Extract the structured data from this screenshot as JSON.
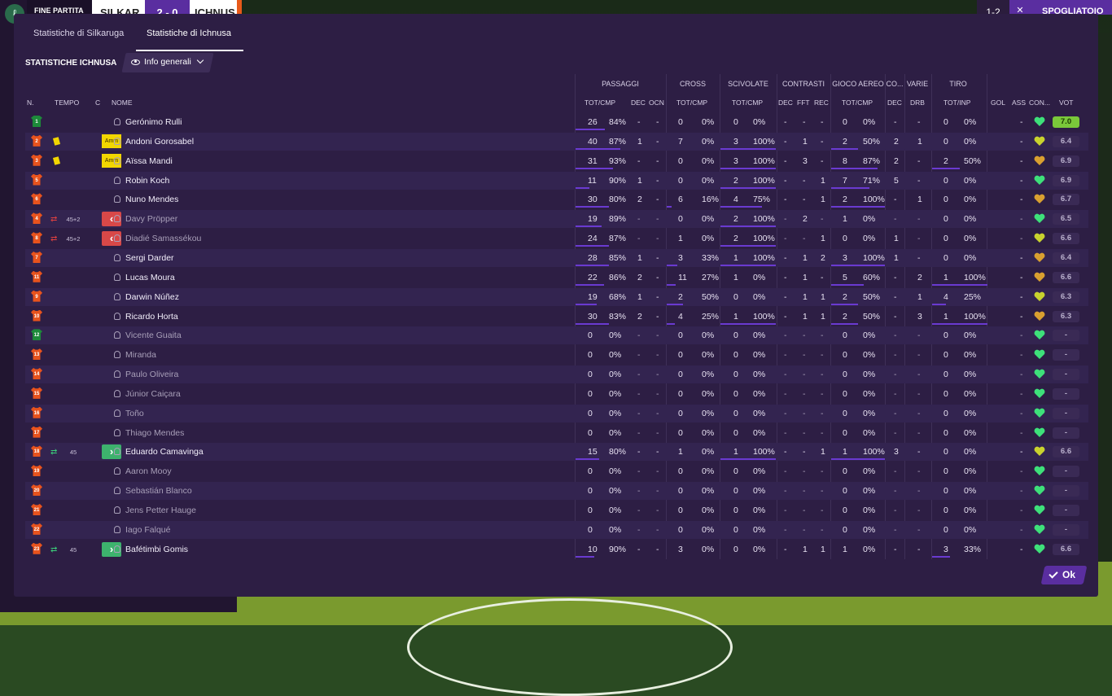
{
  "topbar": {
    "logo_glyph": "ℓ",
    "status": "FINE PARTITA",
    "home_team": "SILKAR",
    "score": "2 - 0",
    "away_team": "ICHNUS",
    "right_a": "1-2",
    "right_b": "✕",
    "right_c": "SPOGLIATOIO"
  },
  "tabs": [
    {
      "label": "Statistiche di Silkaruga",
      "active": false
    },
    {
      "label": "Statistiche di Ichnusa",
      "active": true
    }
  ],
  "section": {
    "title": "STATISTICHE ICHNUSA",
    "dropdown_label": "Info generali",
    "dropdown_icon": "eye-icon"
  },
  "columns": {
    "num": "N.",
    "time": "TEMPO",
    "c": "C",
    "name": "NOME",
    "groups": {
      "passaggi": "PASSAGGI",
      "cross": "CROSS",
      "scivolate": "SCIVOLATE",
      "contrasti": "CONTRASTI",
      "gioco_aereo": "GIOCO AEREO",
      "co": "CO...",
      "varie": "VARIE",
      "tiro": "TIRO"
    },
    "sub": {
      "pass_tot": "TOT/CMP",
      "pass_dec": "DEC",
      "pass_ocn": "OCN",
      "cross_tot": "TOT/CMP",
      "sciv_tot": "TOT/CMP",
      "contr_dec": "DEC",
      "contr_fft": "FFT",
      "contr_rec": "REC",
      "aereo_tot": "TOT/CMP",
      "co_dec": "DEC",
      "varie_drb": "DRB",
      "tiro_tot": "TOT/INP",
      "gol": "GOL",
      "ass": "ASS",
      "con": "CON...",
      "vot": "VOT"
    }
  },
  "colors": {
    "dialog_bg": "#2d1e44",
    "accent": "#5a2ea0",
    "bar": "#6a3ad0",
    "shirt": "#e8531d",
    "gk_shirt": "#1d8a3a",
    "best_rating": "#7ac83a"
  },
  "players": [
    {
      "num": "1",
      "gk": true,
      "name": "Gerónimo Rulli",
      "sub": false,
      "card": "",
      "subdir": "",
      "subtime": "",
      "pass": "26",
      "passpct": "84%",
      "pass_frac": 0.62,
      "pdec": "-",
      "pocn": "-",
      "cross": "0",
      "crosspct": "0%",
      "cross_frac": 0,
      "sciv": "0",
      "scivpct": "0%",
      "sciv_frac": 0,
      "cdec": "-",
      "cfft": "-",
      "crec": "-",
      "aer": "0",
      "aerpct": "0%",
      "aer_frac": 0,
      "codec": "-",
      "drb": "-",
      "tiro": "0",
      "tiropct": "0%",
      "tiro_frac": 0,
      "gol": "",
      "ass": "-",
      "heart": "green",
      "vot": "7.0",
      "best": true
    },
    {
      "num": "2",
      "gk": false,
      "name": "Andoni Gorosabel",
      "sub": false,
      "card": "yellow",
      "amm": "Amm",
      "subdir": "",
      "subtime": "",
      "pass": "40",
      "passpct": "87%",
      "pass_frac": 0.95,
      "pdec": "1",
      "pocn": "-",
      "cross": "7",
      "crosspct": "0%",
      "cross_frac": 0,
      "sciv": "3",
      "scivpct": "100%",
      "sciv_frac": 1,
      "cdec": "-",
      "cfft": "1",
      "crec": "-",
      "aer": "2",
      "aerpct": "50%",
      "aer_frac": 0.5,
      "codec": "2",
      "drb": "1",
      "tiro": "0",
      "tiropct": "0%",
      "tiro_frac": 0,
      "gol": "",
      "ass": "-",
      "heart": "yellow",
      "vot": "6.4",
      "best": false
    },
    {
      "num": "3",
      "gk": false,
      "name": "Aïssa Mandi",
      "sub": false,
      "card": "yellow",
      "amm": "Amm",
      "subdir": "",
      "subtime": "",
      "pass": "31",
      "passpct": "93%",
      "pass_frac": 0.8,
      "pdec": "-",
      "pocn": "-",
      "cross": "0",
      "crosspct": "0%",
      "cross_frac": 0,
      "sciv": "3",
      "scivpct": "100%",
      "sciv_frac": 1,
      "cdec": "-",
      "cfft": "3",
      "crec": "-",
      "aer": "8",
      "aerpct": "87%",
      "aer_frac": 0.87,
      "codec": "2",
      "drb": "-",
      "tiro": "2",
      "tiropct": "50%",
      "tiro_frac": 0.5,
      "gol": "",
      "ass": "-",
      "heart": "orange",
      "vot": "6.9",
      "best": false
    },
    {
      "num": "5",
      "gk": false,
      "name": "Robin Koch",
      "sub": false,
      "card": "",
      "subdir": "",
      "subtime": "",
      "pass": "11",
      "passpct": "90%",
      "pass_frac": 0.3,
      "pdec": "1",
      "pocn": "-",
      "cross": "0",
      "crosspct": "0%",
      "cross_frac": 0,
      "sciv": "2",
      "scivpct": "100%",
      "sciv_frac": 1,
      "cdec": "-",
      "cfft": "-",
      "crec": "1",
      "aer": "7",
      "aerpct": "71%",
      "aer_frac": 0.71,
      "codec": "5",
      "drb": "-",
      "tiro": "0",
      "tiropct": "0%",
      "tiro_frac": 0,
      "gol": "",
      "ass": "-",
      "heart": "green",
      "vot": "6.9",
      "best": false
    },
    {
      "num": "6",
      "gk": false,
      "name": "Nuno Mendes",
      "sub": false,
      "card": "",
      "subdir": "",
      "subtime": "",
      "pass": "30",
      "passpct": "80%",
      "pass_frac": 0.7,
      "pdec": "2",
      "pocn": "-",
      "cross": "6",
      "crosspct": "16%",
      "cross_frac": 0.16,
      "sciv": "4",
      "scivpct": "75%",
      "sciv_frac": 0.75,
      "cdec": "-",
      "cfft": "-",
      "crec": "1",
      "aer": "2",
      "aerpct": "100%",
      "aer_frac": 1,
      "codec": "-",
      "drb": "1",
      "tiro": "0",
      "tiropct": "0%",
      "tiro_frac": 0,
      "gol": "",
      "ass": "-",
      "heart": "orange",
      "vot": "6.7",
      "best": false
    },
    {
      "num": "4",
      "gk": false,
      "name": "Davy Pröpper",
      "sub": true,
      "card": "",
      "subdir": "out",
      "subtime": "45+2",
      "pass": "19",
      "passpct": "89%",
      "pass_frac": 0.55,
      "pdec": "-",
      "pocn": "-",
      "cross": "0",
      "crosspct": "0%",
      "cross_frac": 0,
      "sciv": "2",
      "scivpct": "100%",
      "sciv_frac": 1,
      "cdec": "-",
      "cfft": "2",
      "crec": "-",
      "aer": "1",
      "aerpct": "0%",
      "aer_frac": 0,
      "codec": "-",
      "drb": "-",
      "tiro": "0",
      "tiropct": "0%",
      "tiro_frac": 0,
      "gol": "",
      "ass": "-",
      "heart": "green",
      "vot": "6.5",
      "best": false
    },
    {
      "num": "8",
      "gk": false,
      "name": "Diadié Samassékou",
      "sub": true,
      "card": "",
      "subdir": "out",
      "subtime": "45+2",
      "pass": "24",
      "passpct": "87%",
      "pass_frac": 0.7,
      "pdec": "-",
      "pocn": "-",
      "cross": "1",
      "crosspct": "0%",
      "cross_frac": 0,
      "sciv": "2",
      "scivpct": "100%",
      "sciv_frac": 1,
      "cdec": "-",
      "cfft": "-",
      "crec": "1",
      "aer": "0",
      "aerpct": "0%",
      "aer_frac": 0,
      "codec": "1",
      "drb": "-",
      "tiro": "0",
      "tiropct": "0%",
      "tiro_frac": 0,
      "gol": "",
      "ass": "-",
      "heart": "yellow",
      "vot": "6.6",
      "best": false
    },
    {
      "num": "7",
      "gk": false,
      "name": "Sergi Darder",
      "sub": false,
      "card": "",
      "subdir": "",
      "subtime": "",
      "pass": "28",
      "passpct": "85%",
      "pass_frac": 0.7,
      "pdec": "1",
      "pocn": "-",
      "cross": "3",
      "crosspct": "33%",
      "cross_frac": 0.33,
      "sciv": "1",
      "scivpct": "100%",
      "sciv_frac": 1,
      "cdec": "-",
      "cfft": "1",
      "crec": "2",
      "aer": "3",
      "aerpct": "100%",
      "aer_frac": 1,
      "codec": "1",
      "drb": "-",
      "tiro": "0",
      "tiropct": "0%",
      "tiro_frac": 0,
      "gol": "",
      "ass": "-",
      "heart": "orange",
      "vot": "6.4",
      "best": false
    },
    {
      "num": "11",
      "gk": false,
      "name": "Lucas Moura",
      "sub": false,
      "card": "",
      "subdir": "",
      "subtime": "",
      "pass": "22",
      "passpct": "86%",
      "pass_frac": 0.6,
      "pdec": "2",
      "pocn": "-",
      "cross": "11",
      "crosspct": "27%",
      "cross_frac": 0.27,
      "sciv": "1",
      "scivpct": "0%",
      "sciv_frac": 0,
      "cdec": "-",
      "cfft": "1",
      "crec": "-",
      "aer": "5",
      "aerpct": "60%",
      "aer_frac": 0.6,
      "codec": "-",
      "drb": "2",
      "tiro": "1",
      "tiropct": "100%",
      "tiro_frac": 1,
      "gol": "",
      "ass": "-",
      "heart": "orange",
      "vot": "6.6",
      "best": false
    },
    {
      "num": "9",
      "gk": false,
      "name": "Darwin Núñez",
      "sub": false,
      "card": "",
      "subdir": "",
      "subtime": "",
      "pass": "19",
      "passpct": "68%",
      "pass_frac": 0.45,
      "pdec": "1",
      "pocn": "-",
      "cross": "2",
      "crosspct": "50%",
      "cross_frac": 0.5,
      "sciv": "0",
      "scivpct": "0%",
      "sciv_frac": 0,
      "cdec": "-",
      "cfft": "1",
      "crec": "1",
      "aer": "2",
      "aerpct": "50%",
      "aer_frac": 0.5,
      "codec": "-",
      "drb": "1",
      "tiro": "4",
      "tiropct": "25%",
      "tiro_frac": 0.25,
      "gol": "",
      "ass": "-",
      "heart": "yellow",
      "vot": "6.3",
      "best": false
    },
    {
      "num": "10",
      "gk": false,
      "name": "Ricardo Horta",
      "sub": false,
      "card": "",
      "subdir": "",
      "subtime": "",
      "pass": "30",
      "passpct": "83%",
      "pass_frac": 0.7,
      "pdec": "2",
      "pocn": "-",
      "cross": "4",
      "crosspct": "25%",
      "cross_frac": 0.25,
      "sciv": "1",
      "scivpct": "100%",
      "sciv_frac": 1,
      "cdec": "-",
      "cfft": "1",
      "crec": "1",
      "aer": "2",
      "aerpct": "50%",
      "aer_frac": 0.5,
      "codec": "-",
      "drb": "3",
      "tiro": "1",
      "tiropct": "100%",
      "tiro_frac": 1,
      "gol": "",
      "ass": "-",
      "heart": "orange",
      "vot": "6.3",
      "best": false
    },
    {
      "num": "12",
      "gk": true,
      "name": "Vicente Guaita",
      "sub": true,
      "card": "",
      "subdir": "",
      "subtime": "",
      "pass": "0",
      "passpct": "0%",
      "pass_frac": 0,
      "pdec": "-",
      "pocn": "-",
      "cross": "0",
      "crosspct": "0%",
      "cross_frac": 0,
      "sciv": "0",
      "scivpct": "0%",
      "sciv_frac": 0,
      "cdec": "-",
      "cfft": "-",
      "crec": "-",
      "aer": "0",
      "aerpct": "0%",
      "aer_frac": 0,
      "codec": "-",
      "drb": "-",
      "tiro": "0",
      "tiropct": "0%",
      "tiro_frac": 0,
      "gol": "",
      "ass": "-",
      "heart": "green",
      "vot": "-",
      "best": false
    },
    {
      "num": "13",
      "gk": false,
      "name": "Miranda",
      "sub": true,
      "card": "",
      "subdir": "",
      "subtime": "",
      "pass": "0",
      "passpct": "0%",
      "pass_frac": 0,
      "pdec": "-",
      "pocn": "-",
      "cross": "0",
      "crosspct": "0%",
      "cross_frac": 0,
      "sciv": "0",
      "scivpct": "0%",
      "sciv_frac": 0,
      "cdec": "-",
      "cfft": "-",
      "crec": "-",
      "aer": "0",
      "aerpct": "0%",
      "aer_frac": 0,
      "codec": "-",
      "drb": "-",
      "tiro": "0",
      "tiropct": "0%",
      "tiro_frac": 0,
      "gol": "",
      "ass": "-",
      "heart": "green",
      "vot": "-",
      "best": false
    },
    {
      "num": "14",
      "gk": false,
      "name": "Paulo Oliveira",
      "sub": true,
      "card": "",
      "subdir": "",
      "subtime": "",
      "pass": "0",
      "passpct": "0%",
      "pass_frac": 0,
      "pdec": "-",
      "pocn": "-",
      "cross": "0",
      "crosspct": "0%",
      "cross_frac": 0,
      "sciv": "0",
      "scivpct": "0%",
      "sciv_frac": 0,
      "cdec": "-",
      "cfft": "-",
      "crec": "-",
      "aer": "0",
      "aerpct": "0%",
      "aer_frac": 0,
      "codec": "-",
      "drb": "-",
      "tiro": "0",
      "tiropct": "0%",
      "tiro_frac": 0,
      "gol": "",
      "ass": "-",
      "heart": "green",
      "vot": "-",
      "best": false
    },
    {
      "num": "15",
      "gk": false,
      "name": "Júnior Caiçara",
      "sub": true,
      "card": "",
      "subdir": "",
      "subtime": "",
      "pass": "0",
      "passpct": "0%",
      "pass_frac": 0,
      "pdec": "-",
      "pocn": "-",
      "cross": "0",
      "crosspct": "0%",
      "cross_frac": 0,
      "sciv": "0",
      "scivpct": "0%",
      "sciv_frac": 0,
      "cdec": "-",
      "cfft": "-",
      "crec": "-",
      "aer": "0",
      "aerpct": "0%",
      "aer_frac": 0,
      "codec": "-",
      "drb": "-",
      "tiro": "0",
      "tiropct": "0%",
      "tiro_frac": 0,
      "gol": "",
      "ass": "-",
      "heart": "green",
      "vot": "-",
      "best": false
    },
    {
      "num": "16",
      "gk": false,
      "name": "Toño",
      "sub": true,
      "card": "",
      "subdir": "",
      "subtime": "",
      "pass": "0",
      "passpct": "0%",
      "pass_frac": 0,
      "pdec": "-",
      "pocn": "-",
      "cross": "0",
      "crosspct": "0%",
      "cross_frac": 0,
      "sciv": "0",
      "scivpct": "0%",
      "sciv_frac": 0,
      "cdec": "-",
      "cfft": "-",
      "crec": "-",
      "aer": "0",
      "aerpct": "0%",
      "aer_frac": 0,
      "codec": "-",
      "drb": "-",
      "tiro": "0",
      "tiropct": "0%",
      "tiro_frac": 0,
      "gol": "",
      "ass": "-",
      "heart": "green",
      "vot": "-",
      "best": false
    },
    {
      "num": "17",
      "gk": false,
      "name": "Thiago Mendes",
      "sub": true,
      "card": "",
      "subdir": "",
      "subtime": "",
      "pass": "0",
      "passpct": "0%",
      "pass_frac": 0,
      "pdec": "-",
      "pocn": "-",
      "cross": "0",
      "crosspct": "0%",
      "cross_frac": 0,
      "sciv": "0",
      "scivpct": "0%",
      "sciv_frac": 0,
      "cdec": "-",
      "cfft": "-",
      "crec": "-",
      "aer": "0",
      "aerpct": "0%",
      "aer_frac": 0,
      "codec": "-",
      "drb": "-",
      "tiro": "0",
      "tiropct": "0%",
      "tiro_frac": 0,
      "gol": "",
      "ass": "-",
      "heart": "green",
      "vot": "-",
      "best": false
    },
    {
      "num": "18",
      "gk": false,
      "name": "Eduardo Camavinga",
      "sub": false,
      "card": "",
      "subdir": "in",
      "subtime": "45",
      "pass": "15",
      "passpct": "80%",
      "pass_frac": 0.5,
      "pdec": "-",
      "pocn": "-",
      "cross": "1",
      "crosspct": "0%",
      "cross_frac": 0,
      "sciv": "1",
      "scivpct": "100%",
      "sciv_frac": 1,
      "cdec": "-",
      "cfft": "-",
      "crec": "1",
      "aer": "1",
      "aerpct": "100%",
      "aer_frac": 1,
      "codec": "3",
      "drb": "-",
      "tiro": "0",
      "tiropct": "0%",
      "tiro_frac": 0,
      "gol": "",
      "ass": "-",
      "heart": "yellow",
      "vot": "6.6",
      "best": false
    },
    {
      "num": "19",
      "gk": false,
      "name": "Aaron Mooy",
      "sub": true,
      "card": "",
      "subdir": "",
      "subtime": "",
      "pass": "0",
      "passpct": "0%",
      "pass_frac": 0,
      "pdec": "-",
      "pocn": "-",
      "cross": "0",
      "crosspct": "0%",
      "cross_frac": 0,
      "sciv": "0",
      "scivpct": "0%",
      "sciv_frac": 0,
      "cdec": "-",
      "cfft": "-",
      "crec": "-",
      "aer": "0",
      "aerpct": "0%",
      "aer_frac": 0,
      "codec": "-",
      "drb": "-",
      "tiro": "0",
      "tiropct": "0%",
      "tiro_frac": 0,
      "gol": "",
      "ass": "-",
      "heart": "green",
      "vot": "-",
      "best": false
    },
    {
      "num": "20",
      "gk": false,
      "name": "Sebastián Blanco",
      "sub": true,
      "card": "",
      "subdir": "",
      "subtime": "",
      "pass": "0",
      "passpct": "0%",
      "pass_frac": 0,
      "pdec": "-",
      "pocn": "-",
      "cross": "0",
      "crosspct": "0%",
      "cross_frac": 0,
      "sciv": "0",
      "scivpct": "0%",
      "sciv_frac": 0,
      "cdec": "-",
      "cfft": "-",
      "crec": "-",
      "aer": "0",
      "aerpct": "0%",
      "aer_frac": 0,
      "codec": "-",
      "drb": "-",
      "tiro": "0",
      "tiropct": "0%",
      "tiro_frac": 0,
      "gol": "",
      "ass": "-",
      "heart": "green",
      "vot": "-",
      "best": false
    },
    {
      "num": "21",
      "gk": false,
      "name": "Jens Petter Hauge",
      "sub": true,
      "card": "",
      "subdir": "",
      "subtime": "",
      "pass": "0",
      "passpct": "0%",
      "pass_frac": 0,
      "pdec": "-",
      "pocn": "-",
      "cross": "0",
      "crosspct": "0%",
      "cross_frac": 0,
      "sciv": "0",
      "scivpct": "0%",
      "sciv_frac": 0,
      "cdec": "-",
      "cfft": "-",
      "crec": "-",
      "aer": "0",
      "aerpct": "0%",
      "aer_frac": 0,
      "codec": "-",
      "drb": "-",
      "tiro": "0",
      "tiropct": "0%",
      "tiro_frac": 0,
      "gol": "",
      "ass": "-",
      "heart": "green",
      "vot": "-",
      "best": false
    },
    {
      "num": "22",
      "gk": false,
      "name": "Iago Falqué",
      "sub": true,
      "card": "",
      "subdir": "",
      "subtime": "",
      "pass": "0",
      "passpct": "0%",
      "pass_frac": 0,
      "pdec": "-",
      "pocn": "-",
      "cross": "0",
      "crosspct": "0%",
      "cross_frac": 0,
      "sciv": "0",
      "scivpct": "0%",
      "sciv_frac": 0,
      "cdec": "-",
      "cfft": "-",
      "crec": "-",
      "aer": "0",
      "aerpct": "0%",
      "aer_frac": 0,
      "codec": "-",
      "drb": "-",
      "tiro": "0",
      "tiropct": "0%",
      "tiro_frac": 0,
      "gol": "",
      "ass": "-",
      "heart": "green",
      "vot": "-",
      "best": false
    },
    {
      "num": "23",
      "gk": false,
      "name": "Bafétimbi Gomis",
      "sub": false,
      "card": "",
      "subdir": "in",
      "subtime": "45",
      "pass": "10",
      "passpct": "90%",
      "pass_frac": 0.4,
      "pdec": "-",
      "pocn": "-",
      "cross": "3",
      "crosspct": "0%",
      "cross_frac": 0,
      "sciv": "0",
      "scivpct": "0%",
      "sciv_frac": 0,
      "cdec": "-",
      "cfft": "1",
      "crec": "1",
      "aer": "1",
      "aerpct": "0%",
      "aer_frac": 0,
      "codec": "-",
      "drb": "-",
      "tiro": "3",
      "tiropct": "33%",
      "tiro_frac": 0.33,
      "gol": "",
      "ass": "-",
      "heart": "green",
      "vot": "6.6",
      "best": false
    }
  ],
  "footer": {
    "ok_label": "Ok"
  }
}
